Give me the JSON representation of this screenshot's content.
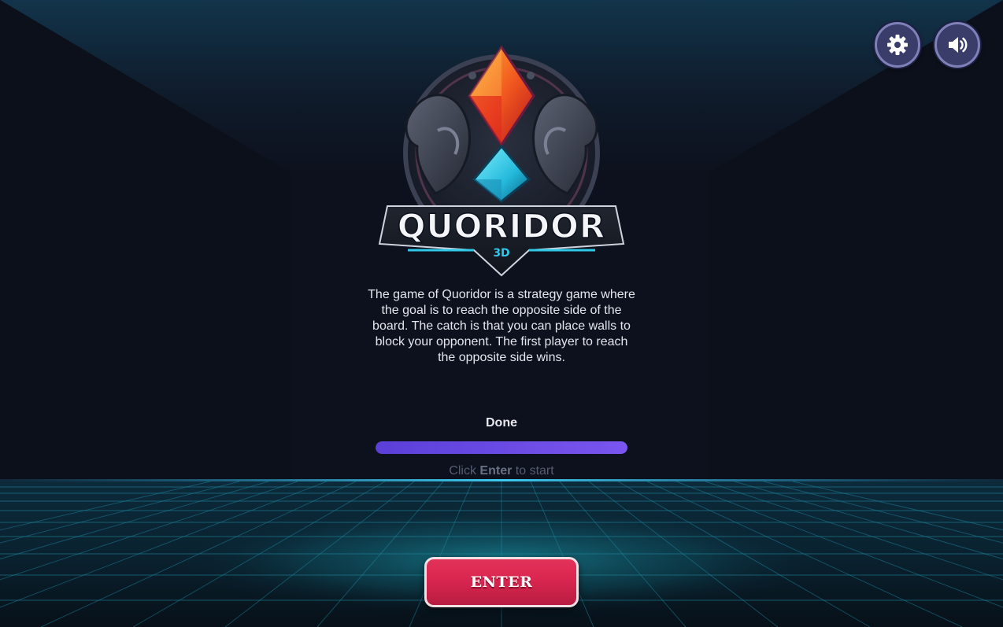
{
  "logo": {
    "title": "QUORIDOR",
    "subtitle": "3D"
  },
  "intro": {
    "description": "The game of Quoridor is a strategy game where the goal is to reach the opposite side of the board. The catch is that you can place walls to block your opponent. The first player to reach the opposite side wins."
  },
  "loading": {
    "status": "Done",
    "progress": 1.0,
    "hint_prefix": "Click",
    "hint_key": "Enter",
    "hint_suffix": "to start"
  },
  "buttons": {
    "enter_label": "ENTER",
    "settings_icon": "gear-icon",
    "sound_icon": "speaker-icon"
  },
  "colors": {
    "background": "#0d111d",
    "accent_cyan": "#2ec8e8",
    "progress_purple": "#6a4ae6",
    "enter_red": "#d92650"
  }
}
